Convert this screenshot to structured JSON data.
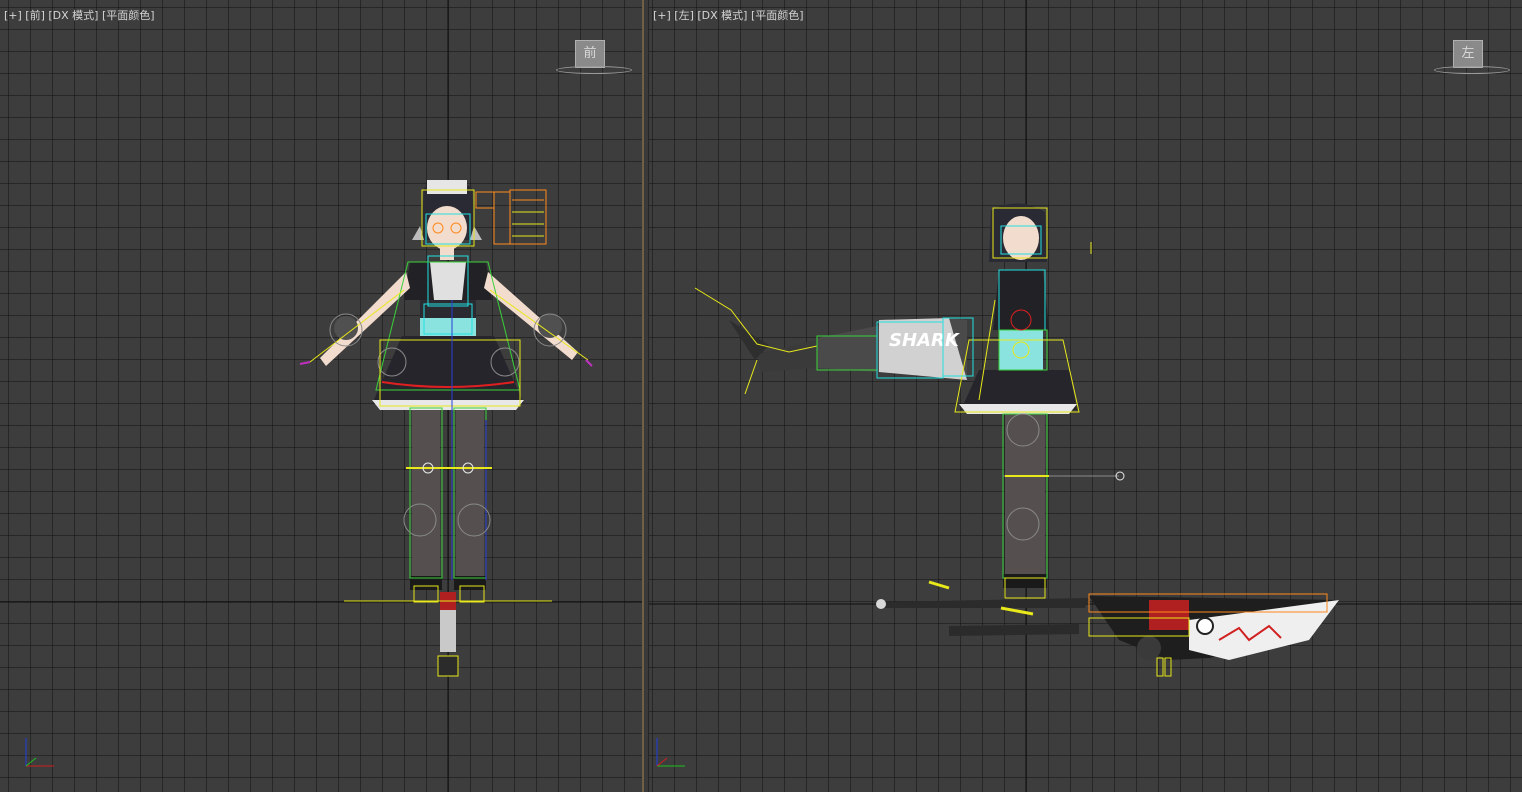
{
  "viewports": {
    "front": {
      "label": "[+] [前] [DX 模式] [平面颜色]",
      "viewcube_label": "前"
    },
    "left": {
      "label": "[+] [左] [DX 模式] [平面颜色]",
      "viewcube_label": "左",
      "weapon_text": "SHARK"
    }
  },
  "colors": {
    "background": "#3d3d3d",
    "grid": "#2a2a2a",
    "bone_yellow": "#e8e81a",
    "bone_cyan": "#22e0e0",
    "bone_green": "#3ad23a",
    "bone_orange": "#ff8a1e",
    "bone_blue": "#2a3fd6",
    "bone_red": "#e02020",
    "bone_magenta": "#c030c0"
  },
  "icons": {
    "axis_gizmo": "axis-xyz-icon",
    "viewcube": "viewcube-icon"
  }
}
